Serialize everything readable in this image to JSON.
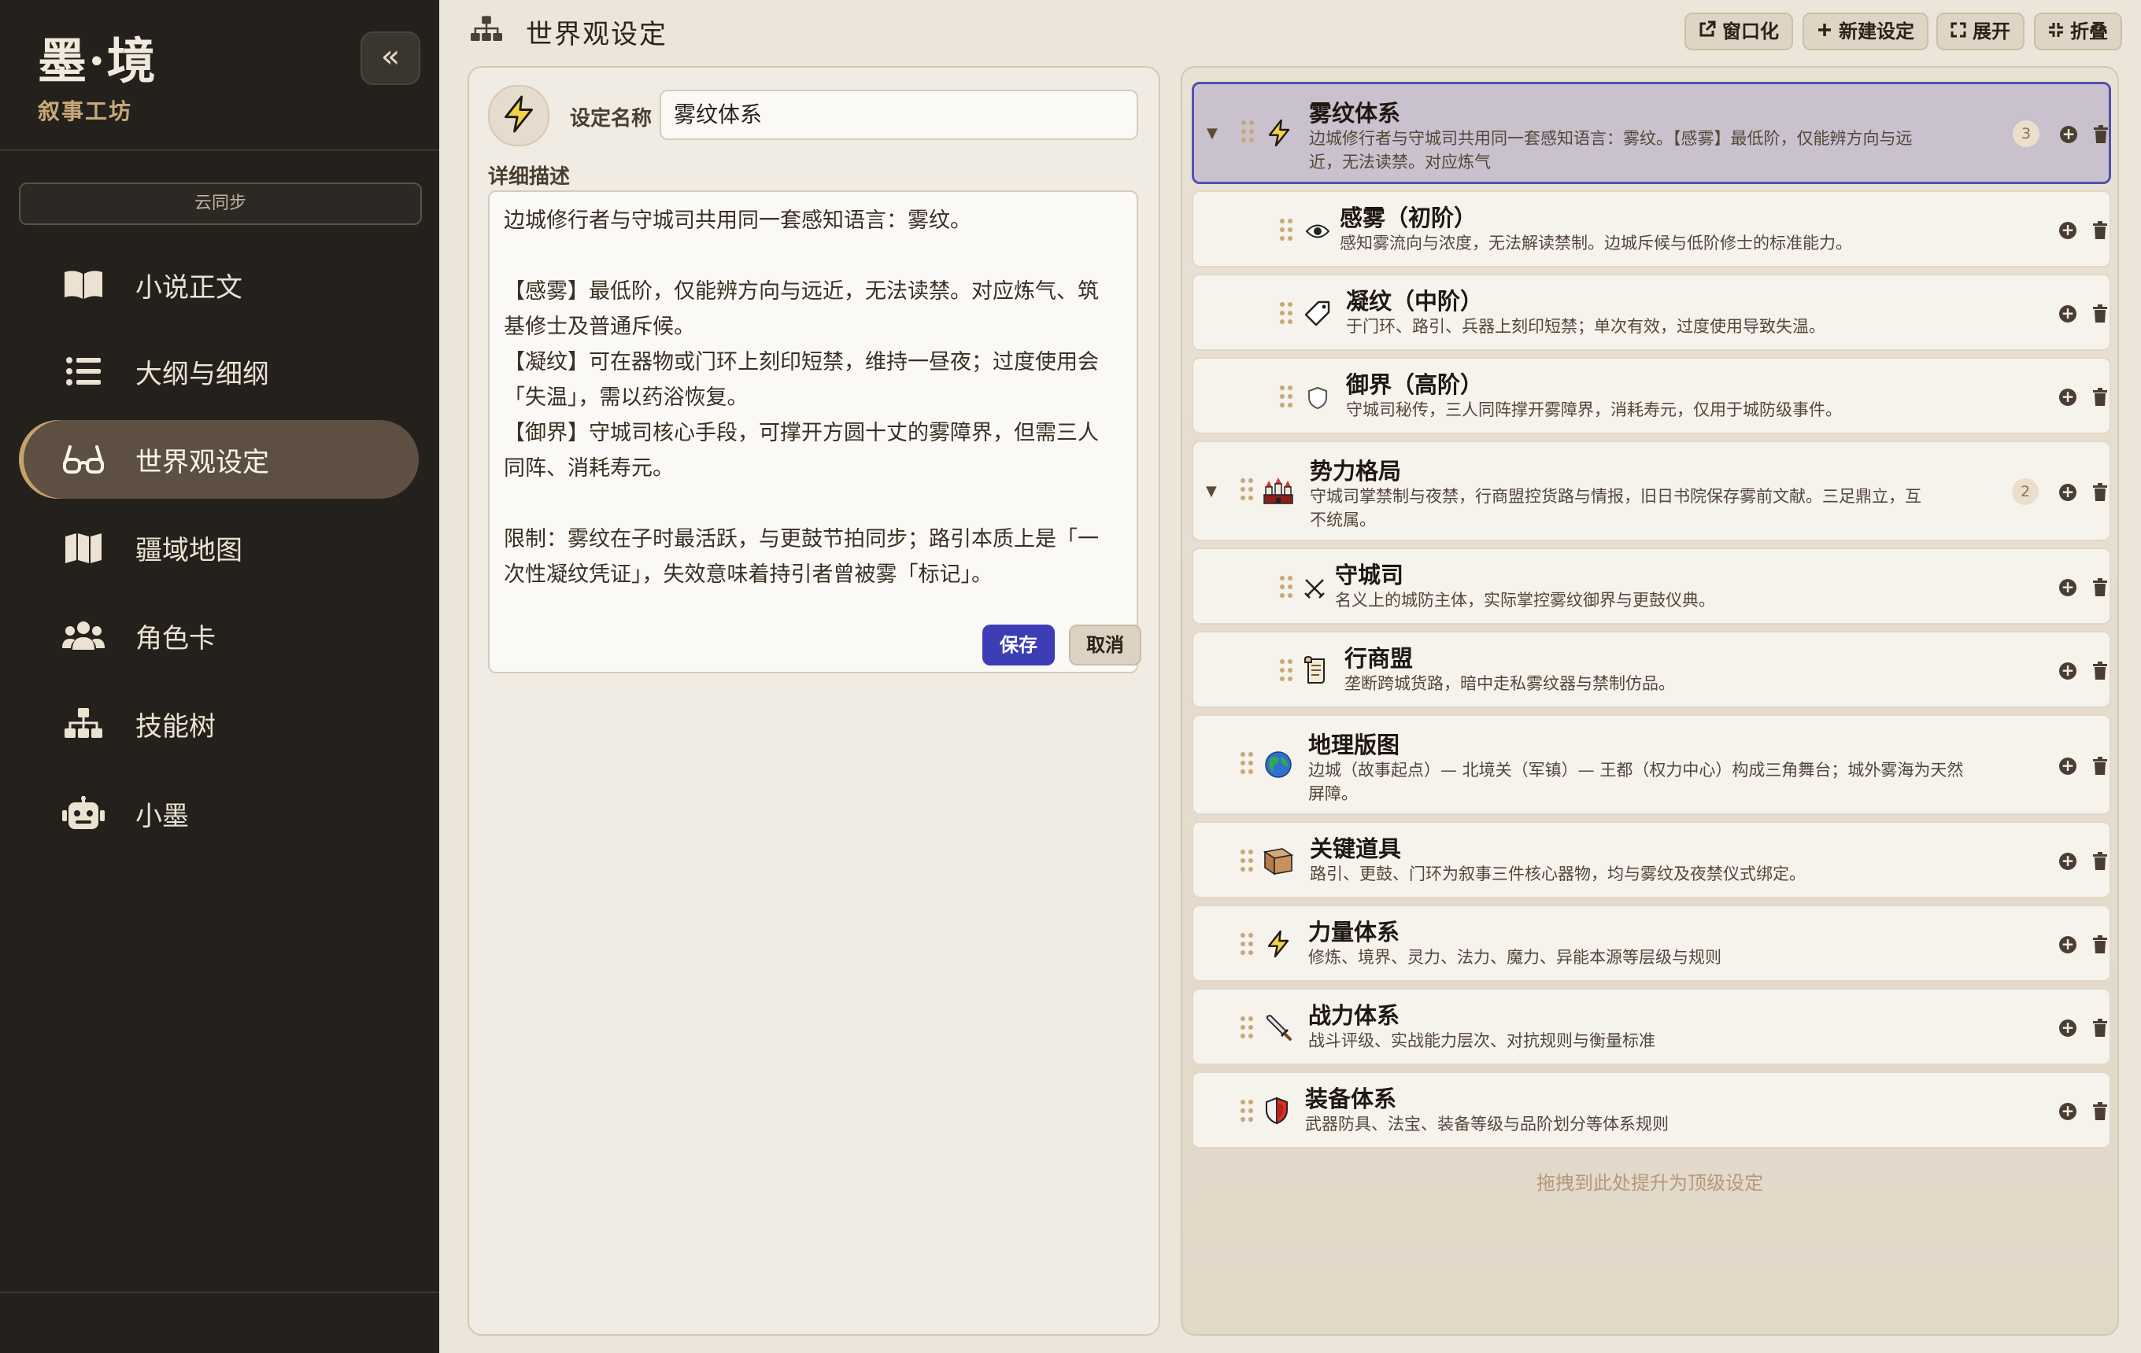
{
  "app": {
    "title": "墨·境",
    "subtitle": "叙事工坊",
    "collapse_glyph": "«"
  },
  "sidebar": {
    "sync_label": "云同步",
    "items": [
      {
        "label": "小说正文",
        "icon": "book-icon",
        "active": false
      },
      {
        "label": "大纲与细纲",
        "icon": "list-icon",
        "active": false
      },
      {
        "label": "世界观设定",
        "icon": "glasses-icon",
        "active": true
      },
      {
        "label": "疆域地图",
        "icon": "map-icon",
        "active": false
      },
      {
        "label": "角色卡",
        "icon": "users-icon",
        "active": false
      },
      {
        "label": "技能树",
        "icon": "hierarchy-icon",
        "active": false
      },
      {
        "label": "小墨",
        "icon": "robot-icon",
        "active": false
      }
    ]
  },
  "header": {
    "title": "世界观设定",
    "buttons": {
      "window": "窗口化",
      "new": "新建设定",
      "expand": "展开",
      "fold": "折叠"
    }
  },
  "editor": {
    "name_label": "设定名称",
    "name_value": "雾纹体系",
    "desc_label": "详细描述",
    "desc_lines": [
      "边城修行者与守城司共用同一套感知语言：雾纹。",
      "",
      "【感雾】最低阶，仅能辨方向与远近，无法读禁。对应炼气、筑",
      "基修士及普通斥候。",
      "【凝纹】可在器物或门环上刻印短禁，维持一昼夜；过度使用会",
      "「失温」，需以药浴恢复。",
      "【御界】守城司核心手段，可撑开方圆十丈的雾障界，但需三人",
      "同阵、消耗寿元。",
      "",
      "限制：雾纹在子时最活跃，与更鼓节拍同步；路引本质上是「一",
      "次性凝纹凭证」，失效意味着持引者曾被雾「标记」。"
    ],
    "save_label": "保存",
    "cancel_label": "取消",
    "icon": "lightning-icon"
  },
  "tree": {
    "drop_hint": "拖拽到此处提升为顶级设定",
    "items": [
      {
        "title": "雾纹体系",
        "desc1": "边城修行者与守城司共用同一套感知语言：雾纹。【感雾】最低阶，仅能辨方向与远",
        "desc2": "近，无法读禁。对应炼气",
        "count": "3",
        "icon": "lightning-icon"
      },
      {
        "title": "感雾（初阶）",
        "desc1": "感知雾流向与浓度，无法解读禁制。边城斥候与低阶修士的标准能力。",
        "icon": "eye-icon"
      },
      {
        "title": "凝纹（中阶）",
        "desc1": "于门环、路引、兵器上刻印短禁；单次有效，过度使用导致失温。",
        "icon": "tag-icon"
      },
      {
        "title": "御界（高阶）",
        "desc1": "守城司秘传，三人同阵撑开雾障界，消耗寿元，仅用于城防级事件。",
        "icon": "shield-outline-icon"
      },
      {
        "title": "势力格局",
        "desc1": "守城司掌禁制与夜禁，行商盟控货路与情报，旧日书院保存雾前文献。三足鼎立，互",
        "desc2": "不统属。",
        "count": "2",
        "icon": "castle-icon"
      },
      {
        "title": "守城司",
        "desc1": "名义上的城防主体，实际掌控雾纹御界与更鼓仪典。",
        "icon": "crossed-swords-icon"
      },
      {
        "title": "行商盟",
        "desc1": "垄断跨城货路，暗中走私雾纹器与禁制仿品。",
        "icon": "scroll-icon"
      },
      {
        "title": "地理版图",
        "desc1": "边城（故事起点）— 北境关（军镇）— 王都（权力中心）构成三角舞台；城外雾海为天然",
        "desc2": "屏障。",
        "icon": "globe-icon"
      },
      {
        "title": "关键道具",
        "desc1": "路引、更鼓、门环为叙事三件核心器物，均与雾纹及夜禁仪式绑定。",
        "icon": "box-icon"
      },
      {
        "title": "力量体系",
        "desc1": "修炼、境界、灵力、法力、魔力、异能本源等层级与规则",
        "icon": "lightning-icon"
      },
      {
        "title": "战力体系",
        "desc1": "战斗评级、实战能力层次、对抗规则与衡量标准",
        "icon": "sword-icon"
      },
      {
        "title": "装备体系",
        "desc1": "武器防具、法宝、装备等级与品阶划分等体系规则",
        "icon": "shield-icon"
      }
    ]
  }
}
